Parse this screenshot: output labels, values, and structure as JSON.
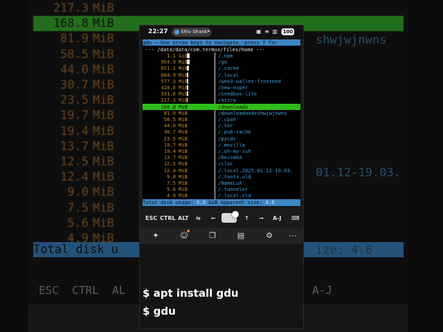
{
  "background": {
    "rows": [
      {
        "size": "217.3",
        "unit": "MiB",
        "selected": false
      },
      {
        "size": "168.8",
        "unit": "MiB",
        "selected": true
      },
      {
        "size": "81.9",
        "unit": "MiB",
        "selected": false
      },
      {
        "size": "58.5",
        "unit": "MiB",
        "selected": false
      },
      {
        "size": "44.0",
        "unit": "MiB",
        "selected": false
      },
      {
        "size": "30.7",
        "unit": "MiB",
        "selected": false
      },
      {
        "size": "23.5",
        "unit": "MiB",
        "selected": false
      },
      {
        "size": "19.7",
        "unit": "MiB",
        "selected": false
      },
      {
        "size": "19.4",
        "unit": "MiB",
        "selected": false
      },
      {
        "size": "13.7",
        "unit": "MiB",
        "selected": false
      },
      {
        "size": "12.5",
        "unit": "MiB",
        "selected": false
      },
      {
        "size": "12.4",
        "unit": "MiB",
        "selected": false
      },
      {
        "size": "9.0",
        "unit": "MiB",
        "selected": false
      },
      {
        "size": "7.5",
        "unit": "MiB",
        "selected": false
      },
      {
        "size": "5.6",
        "unit": "MiB",
        "selected": false
      },
      {
        "size": "4.9",
        "unit": "MiB",
        "selected": false
      }
    ],
    "total_text": "Total disk u",
    "right_frag_1": "shwjwjnwns",
    "right_frag_2": "01.12-19.03.",
    "right_frag_3": "ize: 4.6",
    "keys_text": "ESC  CTRL  AL                        →   A-J"
  },
  "status_bar": {
    "time": "22:27",
    "chip_label": "Shiv Shank",
    "menu": "•",
    "icons": "▣ ≡ ▥ ▥",
    "battery": "100"
  },
  "terminal": {
    "header": "gdu ~ Use arrow keys to navigate, press ? for",
    "path": "--- /data/data/com.termux/files/home ---",
    "rows": [
      {
        "size": "1.1",
        "unit": "GiB",
        "name": "/.npm",
        "bar": 0.1,
        "selected": false
      },
      {
        "size": "954.9",
        "unit": "MiB",
        "name": "/go",
        "bar": 0.09,
        "selected": false
      },
      {
        "size": "651.1",
        "unit": "MiB",
        "name": "/.cache",
        "bar": 0.07,
        "selected": false
      },
      {
        "size": "604.9",
        "unit": "MiB",
        "name": "/.local",
        "bar": 0.06,
        "selected": false
      },
      {
        "size": "577.3",
        "unit": "MiB",
        "name": "/web3-wallet-frontend",
        "bar": 0.06,
        "selected": false
      },
      {
        "size": "428.8",
        "unit": "MiB",
        "name": "/new-exper",
        "bar": 0.05,
        "selected": false
      },
      {
        "size": "331.6",
        "unit": "MiB",
        "name": "/seedbox-lite",
        "bar": 0.04,
        "selected": false
      },
      {
        "size": "217.3",
        "unit": "MiB",
        "name": "/astra",
        "bar": 0.02,
        "selected": false
      },
      {
        "size": "168.8",
        "unit": "MiB",
        "name": "/downloads",
        "bar": 0.02,
        "selected": true
      },
      {
        "size": "81.9",
        "unit": "MiB",
        "name": "/downloadasdxshwjwjnwns",
        "bar": 0,
        "selected": false
      },
      {
        "size": "58.5",
        "unit": "MiB",
        "name": "/.cpan",
        "bar": 0,
        "selected": false
      },
      {
        "size": "44.0",
        "unit": "MiB",
        "name": "/.tor",
        "bar": 0,
        "selected": false
      },
      {
        "size": "30.7",
        "unit": "MiB",
        "name": "/.pub-cache",
        "bar": 0,
        "selected": false
      },
      {
        "size": "23.5",
        "unit": "MiB",
        "name": "/pycdc",
        "bar": 0,
        "selected": false
      },
      {
        "size": "19.7",
        "unit": "MiB",
        "name": "/.mozilla",
        "bar": 0,
        "selected": false
      },
      {
        "size": "19.4",
        "unit": "MiB",
        "name": "/.oh-my-zsh",
        "bar": 0,
        "selected": false
      },
      {
        "size": "13.7",
        "unit": "MiB",
        "name": "/DecodeX",
        "bar": 0,
        "selected": false
      },
      {
        "size": "12.5",
        "unit": "MiB",
        "name": "/cloc",
        "bar": 0,
        "selected": false
      },
      {
        "size": "12.4",
        "unit": "MiB",
        "name": "/.local.2025.01.12-19.03.",
        "bar": 0,
        "selected": false
      },
      {
        "size": "9.0",
        "unit": "MiB",
        "name": "/.fonts.old",
        "bar": 0,
        "selected": false
      },
      {
        "size": "7.5",
        "unit": "MiB",
        "name": "/NameLuX",
        "bar": 0,
        "selected": false
      },
      {
        "size": "5.6",
        "unit": "MiB",
        "name": "/.tunneler",
        "bar": 0,
        "selected": false
      },
      {
        "size": "4.9",
        "unit": "MiB",
        "name": "/.local.old",
        "bar": 0,
        "selected": false
      }
    ],
    "footer_label_1": "Total disk usage: ",
    "footer_value_1": "5.3",
    "footer_label_2": " GiB Apparent size: ",
    "footer_value_2": "4.6"
  },
  "extra_keys": {
    "esc": "ESC",
    "ctrl": "CTRL",
    "alt": "ALT",
    "tab": "⇆",
    "left": "←",
    "up": "↑",
    "right": "→",
    "aj": "A-J",
    "keyboard": "⌨"
  },
  "toolbar_icons": [
    "pin-icon",
    "smile-icon",
    "copy-icon",
    "clipboard-icon",
    "settings-icon",
    "more-icon"
  ],
  "toolbar_glyphs": [
    "✦",
    "☺",
    "❐",
    "▤",
    "⚙",
    "⋯"
  ],
  "caption": {
    "line1": "$ apt install gdu",
    "line2": "$ gdu"
  }
}
